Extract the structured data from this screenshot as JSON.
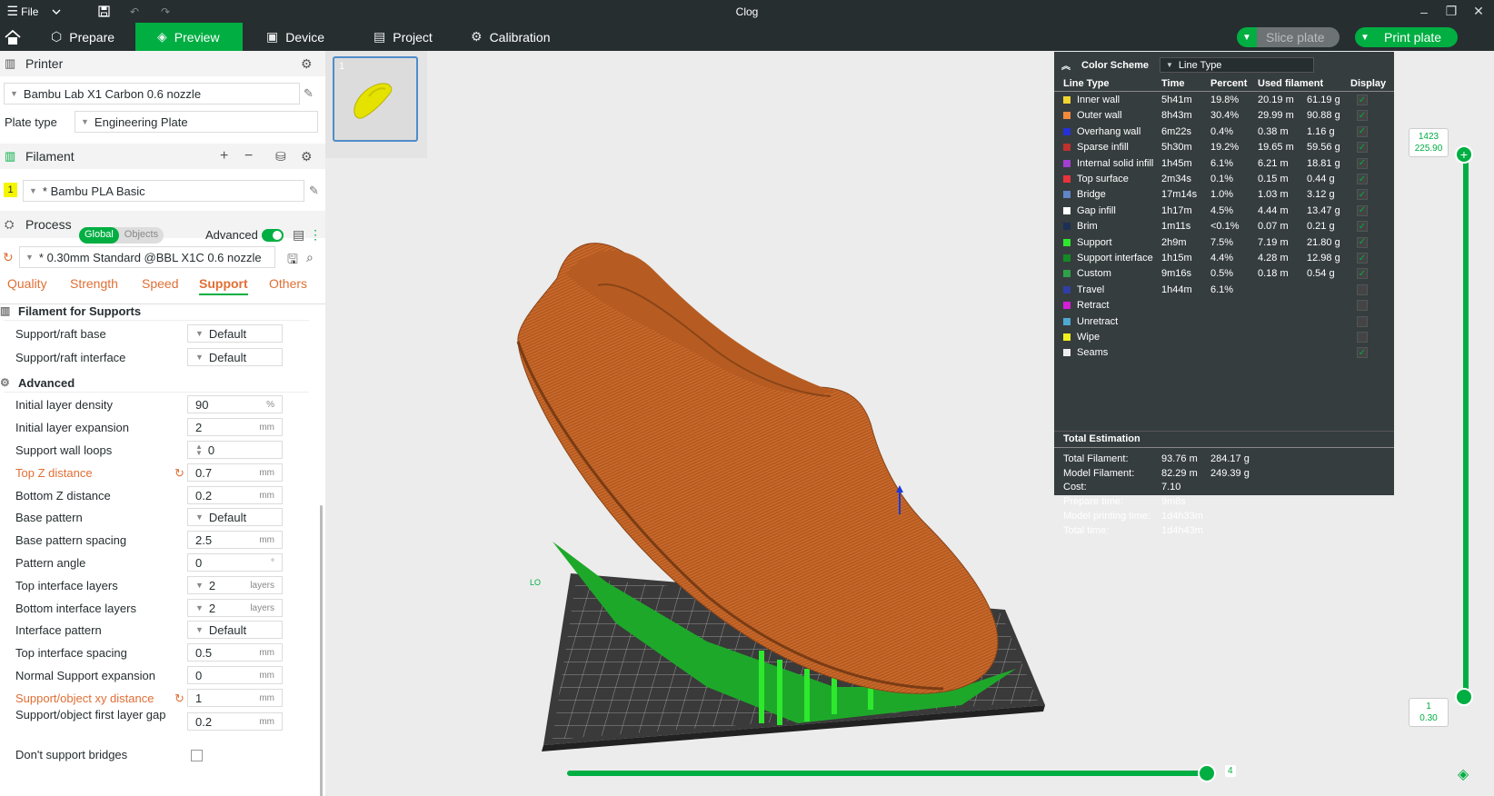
{
  "titlebar": {
    "menu_label": "File",
    "window_title": "Clog",
    "window_controls": [
      "minimize-icon",
      "restore-icon",
      "close-icon"
    ]
  },
  "tabs": [
    {
      "label": "Prepare",
      "icon": "cube-icon"
    },
    {
      "label": "Preview",
      "icon": "layers-icon",
      "active": true
    },
    {
      "label": "Device",
      "icon": "device-icon"
    },
    {
      "label": "Project",
      "icon": "project-icon"
    },
    {
      "label": "Calibration",
      "icon": "calibration-icon"
    }
  ],
  "actions": {
    "slice_label": "Slice plate",
    "print_label": "Print plate"
  },
  "printer": {
    "section_label": "Printer",
    "name": "Bambu Lab X1 Carbon 0.6 nozzle",
    "plate_type_label": "Plate type",
    "plate_type": "Engineering Plate"
  },
  "filament": {
    "section_label": "Filament",
    "slot": "1",
    "name": "* Bambu PLA Basic",
    "slot_color": "#f5f500"
  },
  "process": {
    "section_label": "Process",
    "scope_global": "Global",
    "scope_objects": "Objects",
    "advanced_label": "Advanced",
    "preset": "* 0.30mm Standard @BBL X1C 0.6 nozzle",
    "tabs": [
      "Quality",
      "Strength",
      "Speed",
      "Support",
      "Others"
    ],
    "active_tab": "Support"
  },
  "settings": {
    "group_filament": "Filament for Supports",
    "support_raft_base_label": "Support/raft base",
    "support_raft_base": "Default",
    "support_raft_interface_label": "Support/raft interface",
    "support_raft_interface": "Default",
    "group_advanced": "Advanced",
    "rows": [
      {
        "label": "Initial layer density",
        "value": "90",
        "unit": "%"
      },
      {
        "label": "Initial layer expansion",
        "value": "2",
        "unit": "mm"
      },
      {
        "label": "Support wall loops",
        "value": "0",
        "unit": ""
      },
      {
        "label": "Top Z distance",
        "value": "0.7",
        "unit": "mm",
        "modified": true
      },
      {
        "label": "Bottom Z distance",
        "value": "0.2",
        "unit": "mm"
      },
      {
        "label": "Base pattern",
        "value": "Default",
        "unit": ""
      },
      {
        "label": "Base pattern spacing",
        "value": "2.5",
        "unit": "mm"
      },
      {
        "label": "Pattern angle",
        "value": "0",
        "unit": "°"
      },
      {
        "label": "Top interface layers",
        "value": "2",
        "unit": "layers"
      },
      {
        "label": "Bottom interface layers",
        "value": "2",
        "unit": "layers"
      },
      {
        "label": "Interface pattern",
        "value": "Default",
        "unit": ""
      },
      {
        "label": "Top interface spacing",
        "value": "0.5",
        "unit": "mm"
      },
      {
        "label": "Normal Support expansion",
        "value": "0",
        "unit": "mm"
      },
      {
        "label": "Support/object xy distance",
        "value": "1",
        "unit": "mm",
        "modified": true
      },
      {
        "label": "Support/object first layer gap",
        "value": "0.2",
        "unit": "mm"
      },
      {
        "label": "Don't support bridges",
        "value": "",
        "unit": ""
      }
    ]
  },
  "plate": {
    "number": "1"
  },
  "legend": {
    "title": "Color Scheme",
    "scheme": "Line Type",
    "headers": [
      "Line Type",
      "Time",
      "Percent",
      "Used filament",
      "Display"
    ],
    "rows": [
      {
        "type": "Inner wall",
        "time": "5h41m",
        "percent": "19.8%",
        "length": "20.19 m",
        "weight": "61.19 g",
        "color": "#f2d530",
        "shown": true
      },
      {
        "type": "Outer wall",
        "time": "8h43m",
        "percent": "30.4%",
        "length": "29.99 m",
        "weight": "90.88 g",
        "color": "#f08a3c",
        "shown": true
      },
      {
        "type": "Overhang wall",
        "time": "6m22s",
        "percent": "0.4%",
        "length": "0.38 m",
        "weight": "1.16 g",
        "color": "#2530d8",
        "shown": true
      },
      {
        "type": "Sparse infill",
        "time": "5h30m",
        "percent": "19.2%",
        "length": "19.65 m",
        "weight": "59.56 g",
        "color": "#c0302c",
        "shown": true
      },
      {
        "type": "Internal solid infill",
        "time": "1h45m",
        "percent": "6.1%",
        "length": "6.21 m",
        "weight": "18.81 g",
        "color": "#a33fd0",
        "shown": true
      },
      {
        "type": "Top surface",
        "time": "2m34s",
        "percent": "0.1%",
        "length": "0.15 m",
        "weight": "0.44 g",
        "color": "#e8333a",
        "shown": true
      },
      {
        "type": "Bridge",
        "time": "17m14s",
        "percent": "1.0%",
        "length": "1.03 m",
        "weight": "3.12 g",
        "color": "#5f86c6",
        "shown": true
      },
      {
        "type": "Gap infill",
        "time": "1h17m",
        "percent": "4.5%",
        "length": "4.44 m",
        "weight": "13.47 g",
        "color": "#ffffff",
        "shown": true
      },
      {
        "type": "Brim",
        "time": "1m11s",
        "percent": "<0.1%",
        "length": "0.07 m",
        "weight": "0.21 g",
        "color": "#1d2f54",
        "shown": true
      },
      {
        "type": "Support",
        "time": "2h9m",
        "percent": "7.5%",
        "length": "7.19 m",
        "weight": "21.80 g",
        "color": "#2ee82e",
        "shown": true
      },
      {
        "type": "Support interface",
        "time": "1h15m",
        "percent": "4.4%",
        "length": "4.28 m",
        "weight": "12.98 g",
        "color": "#138a24",
        "shown": true
      },
      {
        "type": "Custom",
        "time": "9m16s",
        "percent": "0.5%",
        "length": "0.18 m",
        "weight": "0.54 g",
        "color": "#2fa04a",
        "shown": true
      },
      {
        "type": "Travel",
        "time": "1h44m",
        "percent": "6.1%",
        "length": "",
        "weight": "",
        "color": "#2f3fa6",
        "shown": false
      },
      {
        "type": "Retract",
        "time": "",
        "percent": "",
        "length": "",
        "weight": "",
        "color": "#d61ed6",
        "shown": false
      },
      {
        "type": "Unretract",
        "time": "",
        "percent": "",
        "length": "",
        "weight": "",
        "color": "#4fa8d2",
        "shown": false
      },
      {
        "type": "Wipe",
        "time": "",
        "percent": "",
        "length": "",
        "weight": "",
        "color": "#f0f020",
        "shown": false
      },
      {
        "type": "Seams",
        "time": "",
        "percent": "",
        "length": "",
        "weight": "",
        "color": "#eeeeee",
        "shown": true
      }
    ],
    "total_title": "Total Estimation",
    "totals": [
      {
        "label": "Total Filament:",
        "v1": "93.76 m",
        "v2": "284.17 g"
      },
      {
        "label": "Model Filament:",
        "v1": "82.29 m",
        "v2": "249.39 g"
      },
      {
        "label": "Cost:",
        "v1": "7.10",
        "v2": ""
      },
      {
        "label": "Prepare time:",
        "v1": "9m8s",
        "v2": ""
      },
      {
        "label": "Model printing time:",
        "v1": "1d4h33m",
        "v2": ""
      },
      {
        "label": "Total time:",
        "v1": "1d4h43m",
        "v2": ""
      }
    ]
  },
  "layer_slider": {
    "top_layer": "1423",
    "top_height": "225.90",
    "bottom_layer": "1",
    "bottom_height": "0.30"
  },
  "move_slider": {
    "value": "4"
  },
  "colors": {
    "accent": "#00ae42",
    "dark": "#262e30",
    "modified": "#e06f35",
    "model": "#c9682a"
  }
}
